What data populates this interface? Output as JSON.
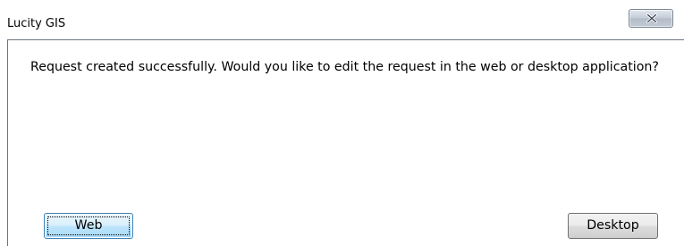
{
  "window": {
    "title": "Lucity GIS",
    "close_icon": "close-x-icon"
  },
  "dialog": {
    "message": "Request created successfully.  Would you like to edit the request in the web or desktop application?",
    "buttons": {
      "web_label": "Web",
      "desktop_label": "Desktop"
    }
  },
  "colors": {
    "focused_button_border": "#3c7fb1",
    "focused_button_fill": "#bee6fd",
    "close_button_fill": "#c5ccd6",
    "frame_border": "#6d7480"
  }
}
